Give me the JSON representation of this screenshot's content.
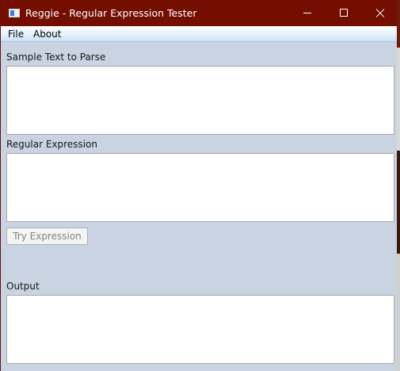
{
  "window": {
    "title": "Reggie - Regular Expression Tester",
    "icon": "app-window-icon",
    "controls": [
      "minimize-icon",
      "maximize-icon",
      "close-icon"
    ]
  },
  "menu": {
    "items": [
      {
        "label": "File"
      },
      {
        "label": "About"
      }
    ]
  },
  "form": {
    "sample_label": "Sample Text to Parse",
    "sample_value": "",
    "regex_label": "Regular Expression",
    "regex_value": "",
    "try_button": "Try Expression",
    "try_button_enabled": false,
    "output_label": "Output",
    "output_value": ""
  },
  "colors": {
    "titlebar": "#730e00",
    "client_background": "#c9d3e2",
    "menubar": "#e4f1fb"
  }
}
